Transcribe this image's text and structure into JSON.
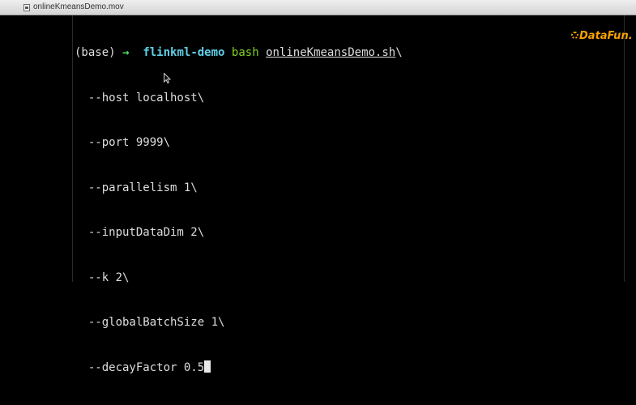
{
  "titlebar": {
    "title": "onlineKmeansDemo.mov",
    "icon": "document-icon"
  },
  "logo": {
    "text": "DataFun.",
    "color": "#f5a000"
  },
  "terminal": {
    "prompt_env": "(base)",
    "prompt_arrow": "→",
    "directory": "flinkml-demo",
    "command": "bash",
    "script": "onlineKmeansDemo.sh",
    "line_continuation": "\\",
    "args": [
      "  --host localhost\\",
      "  --port 9999\\",
      "  --parallelism 1\\",
      "  --inputDataDim 2\\",
      "  --k 2\\",
      "  --globalBatchSize 1\\",
      "  --decayFactor 0.5"
    ],
    "colors": {
      "background": "#000000",
      "text": "#dedede",
      "arrow": "#4fe06a",
      "directory": "#5fd0e8",
      "command": "#7ed321"
    }
  }
}
